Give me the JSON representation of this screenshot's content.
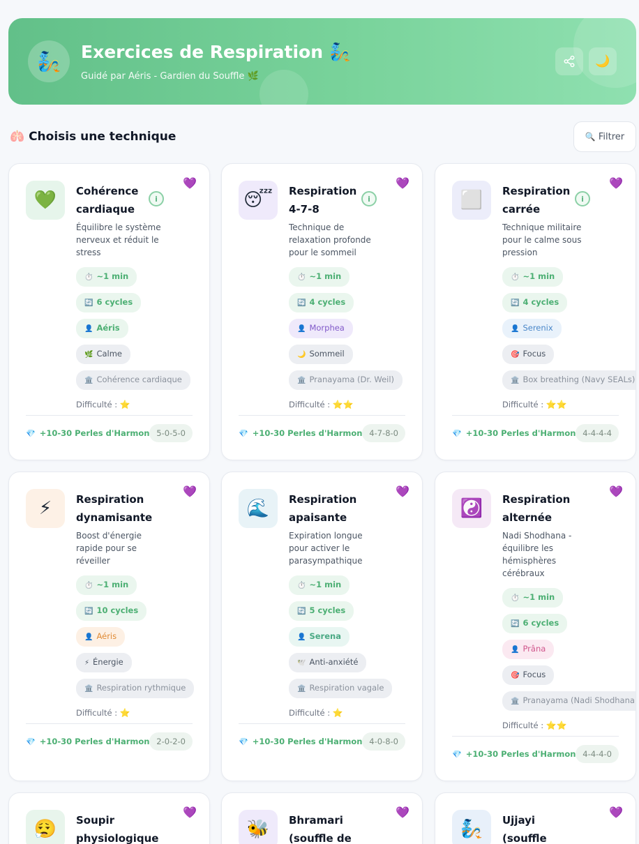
{
  "header": {
    "avatar_icon": "🧞",
    "title": "Exercices de Respiration 🧞",
    "subtitle": "Guidé par Aéris - Gardien du Souffle 🌿",
    "share_icon": "share-icon",
    "theme_icon": "🌙"
  },
  "section": {
    "title": "🫁 Choisis une technique",
    "filter_icon": "🔍",
    "filter_label": "Filtrer"
  },
  "cards": [
    {
      "icon": "💚",
      "icon_bg": "#e6f5eb",
      "name": "Cohérence cardiaque",
      "desc": "Équilibre le système nerveux et réduit le stress",
      "duration": "~1 min",
      "cycles": "6 cycles",
      "guide": "Aéris",
      "guide_style": "t-green",
      "effect_icon": "🌿",
      "effect": "Calme",
      "origin": "Cohérence cardiaque",
      "difficulty_label": "Difficulté :",
      "difficulty_stars": "⭐",
      "reward": "+10-30 Perles d'Harmonie",
      "pattern": "5-0-5-0",
      "has_info": true
    },
    {
      "icon": "😴",
      "icon_bg": "#efeafb",
      "name": "Respiration 4-7-8",
      "desc": "Technique de relaxation profonde pour le sommeil",
      "duration": "~1 min",
      "cycles": "4 cycles",
      "guide": "Morphea",
      "guide_style": "t-purple",
      "effect_icon": "🌙",
      "effect": "Sommeil",
      "origin": "Pranayama (Dr. Weil)",
      "difficulty_label": "Difficulté :",
      "difficulty_stars": "⭐⭐",
      "reward": "+10-30 Perles d'Harmonie",
      "pattern": "4-7-8-0",
      "has_info": true
    },
    {
      "icon": "⬜",
      "icon_bg": "#ecedfa",
      "name": "Respiration carrée",
      "desc": "Technique militaire pour le calme sous pression",
      "duration": "~1 min",
      "cycles": "4 cycles",
      "guide": "Serenix",
      "guide_style": "t-blue",
      "effect_icon": "🎯",
      "effect": "Focus",
      "origin": "Box breathing (Navy SEALs)",
      "difficulty_label": "Difficulté :",
      "difficulty_stars": "⭐⭐",
      "reward": "+10-30 Perles d'Harmonie",
      "pattern": "4-4-4-4",
      "has_info": true
    },
    {
      "icon": "⚡",
      "icon_bg": "#fdf1e6",
      "name": "Respiration dynamisante",
      "desc": "Boost d'énergie rapide pour se réveiller",
      "duration": "~1 min",
      "cycles": "10 cycles",
      "guide": "Aéris",
      "guide_style": "t-orange",
      "effect_icon": "⚡",
      "effect": "Énergie",
      "origin": "Respiration rythmique",
      "difficulty_label": "Difficulté :",
      "difficulty_stars": "⭐",
      "reward": "+10-30 Perles d'Harmonie",
      "pattern": "2-0-2-0",
      "has_info": false
    },
    {
      "icon": "🌊",
      "icon_bg": "#e8f3f7",
      "name": "Respiration apaisante",
      "desc": "Expiration longue pour activer le parasympathique",
      "duration": "~1 min",
      "cycles": "5 cycles",
      "guide": "Serena",
      "guide_style": "t-teal",
      "effect_icon": "🕊️",
      "effect": "Anti-anxiété",
      "origin": "Respiration vagale",
      "difficulty_label": "Difficulté :",
      "difficulty_stars": "⭐",
      "reward": "+10-30 Perles d'Harmonie",
      "pattern": "4-0-8-0",
      "has_info": false
    },
    {
      "icon": "☯️",
      "icon_bg": "#f5e9f6",
      "name": "Respiration alternée",
      "desc": "Nadi Shodhana - équilibre les hémisphères cérébraux",
      "duration": "~1 min",
      "cycles": "6 cycles",
      "guide": "Prâna",
      "guide_style": "t-pink",
      "effect_icon": "🎯",
      "effect": "Focus",
      "origin": "Pranayama (Nadi Shodhana)",
      "difficulty_label": "Difficulté :",
      "difficulty_stars": "⭐⭐",
      "reward": "+10-30 Perles d'Harmonie",
      "pattern": "4-4-4-0",
      "has_info": false
    },
    {
      "icon": "😮‍💨",
      "icon_bg": "#e8f5ec",
      "name": "Soupir physiologique",
      "has_info": false
    },
    {
      "icon": "🐝",
      "icon_bg": "#efeafb",
      "name": "Bhramari (souffle de l'abeille)",
      "has_info": false
    },
    {
      "icon": "🧞",
      "icon_bg": "#e8f0fa",
      "name": "Ujjayi (souffle victorieux)",
      "has_info": false
    }
  ]
}
